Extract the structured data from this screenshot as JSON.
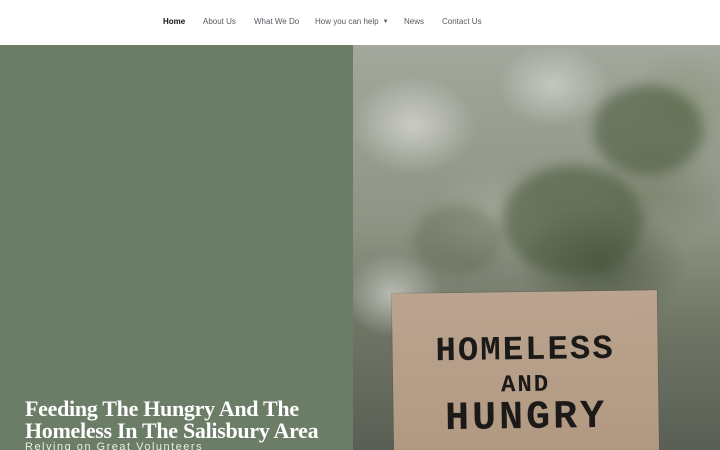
{
  "nav": {
    "items": [
      {
        "label": "Home",
        "active": true
      },
      {
        "label": "About Us"
      },
      {
        "label": "What We Do"
      },
      {
        "label": "How you can help",
        "has_dropdown": true
      },
      {
        "label": "News"
      },
      {
        "label": "Contact Us"
      }
    ]
  },
  "hero": {
    "title": "Feeding The Hungry And The Homeless In The Salisbury Area",
    "subtitle": "Relying on Great Volunteers",
    "sign_lines": [
      "HOMELESS",
      "AND",
      "HUNGRY"
    ]
  },
  "colors": {
    "hero_panel": "#6b7d66",
    "nav_text": "#54595f",
    "nav_active": "#111111"
  }
}
